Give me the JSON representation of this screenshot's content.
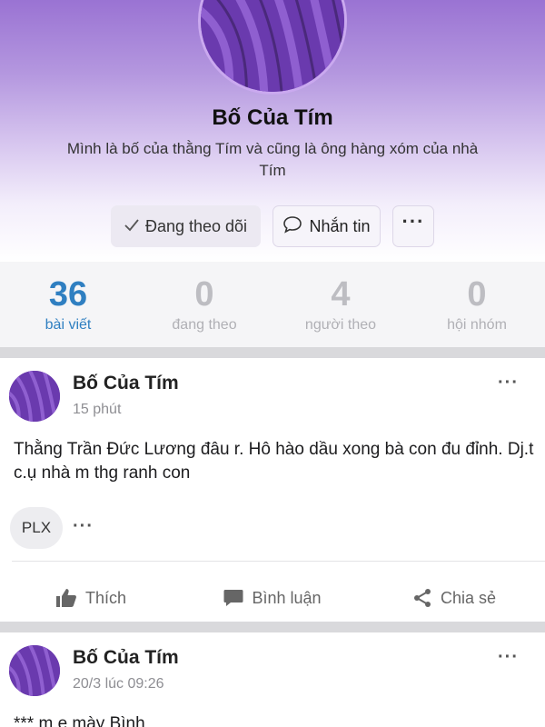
{
  "profile": {
    "name": "Bố Của Tím",
    "bio": "Mình là bố của thằng Tím và cũng là ông hàng xóm của nhà Tím",
    "buttons": {
      "following_label": "Đang theo dõi",
      "message_label": "Nhắn tin",
      "more_label": "···"
    },
    "colors": {
      "accent": "#2f7fc1",
      "header_top": "#9a73d3",
      "avatar_bg": "#6a39b0"
    }
  },
  "stats": [
    {
      "value": "36",
      "label": "bài viết",
      "active": true
    },
    {
      "value": "0",
      "label": "đang theo",
      "active": false
    },
    {
      "value": "4",
      "label": "người theo",
      "active": false
    },
    {
      "value": "0",
      "label": "hội nhóm",
      "active": false
    }
  ],
  "posts": [
    {
      "author": "Bố Của Tím",
      "time": "15 phút",
      "text": "Thằng Trần Đức Lương đâu r. Hô hào dầu xong bà con đu đỉnh. Dj.t c.ụ nhà m thg ranh con",
      "tag": "PLX",
      "more": "···",
      "tag_more": "···",
      "actions": {
        "like": "Thích",
        "comment": "Bình luận",
        "share": "Chia sẻ"
      }
    },
    {
      "author": "Bố Của Tím",
      "time": "20/3 lúc 09:26",
      "text": "*** m e mày Bình",
      "more": "···"
    }
  ]
}
